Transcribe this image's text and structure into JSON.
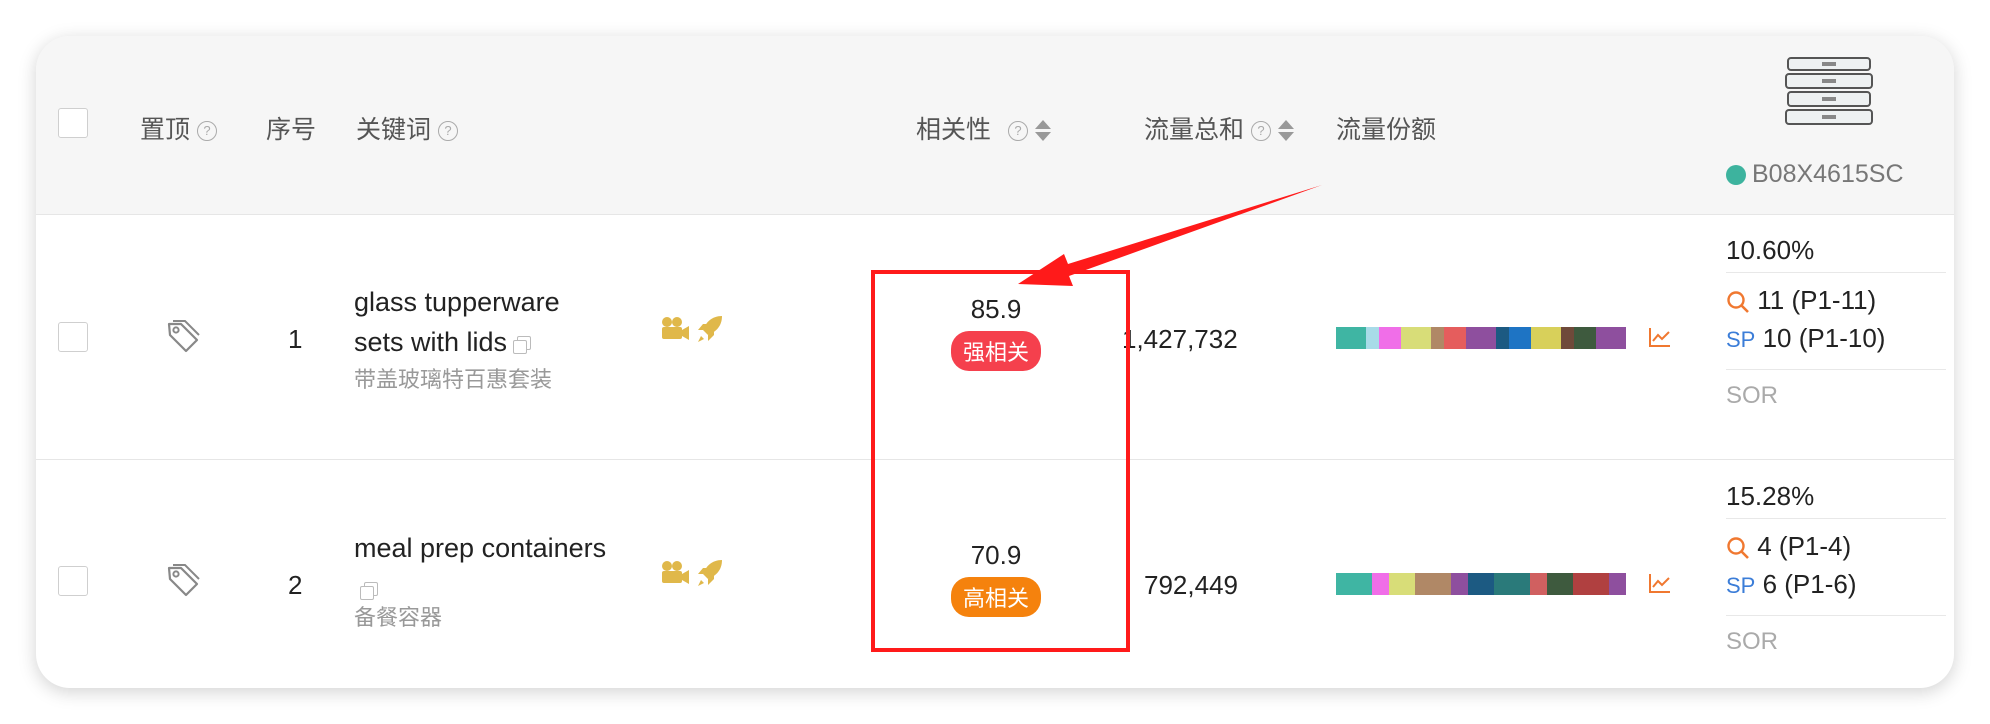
{
  "header": {
    "pin": "置顶",
    "index": "序号",
    "keyword": "关键词",
    "relevance": "相关性",
    "traffic_total": "流量总和",
    "traffic_share": "流量份额",
    "asin": "B08X4615SC",
    "asin_dot_color": "#3db39e"
  },
  "rows": [
    {
      "index": "1",
      "keyword_line1": "glass tupperware",
      "keyword_line2": "sets with lids",
      "keyword_cn": "带盖玻璃特百惠套装",
      "relevance_score": "85.9",
      "relevance_label": "强相关",
      "relevance_color": "#f5404d",
      "traffic": "1,427,732",
      "share_pct": "10.60%",
      "organic_rank": "11 (P1-11)",
      "sp_rank": "10 (P1-10)",
      "sp_label": "SP",
      "sor": "SOR"
    },
    {
      "index": "2",
      "keyword_line1": "meal prep containers",
      "keyword_cn": "备餐容器",
      "relevance_score": "70.9",
      "relevance_label": "高相关",
      "relevance_color": "#f5820d",
      "traffic": "792,449",
      "share_pct": "15.28%",
      "organic_rank": "4 (P1-4)",
      "sp_rank": "6 (P1-6)",
      "sp_label": "SP",
      "sor": "SOR"
    }
  ],
  "share_bar_colors": {
    "row1": [
      "#3fb5a3",
      "#a8dbe8",
      "#f06ee8",
      "#d8dd78",
      "#b08866",
      "#e55d5d",
      "#8e4f9e",
      "#1c5a82",
      "#1e74c4",
      "#d8d05a",
      "#6f4a3a",
      "#3e5a3e",
      "#8e4f9e"
    ],
    "row2": [
      "#3fb5a3",
      "#f06ee8",
      "#d8dd78",
      "#b08866",
      "#8e4f9e",
      "#1c5a82",
      "#2a7a7a",
      "#d06060",
      "#3e5a3e",
      "#b04040",
      "#8e4f9e"
    ]
  },
  "annotation_color": "#ff1a1a",
  "accent_orange": "#f07830",
  "sp_color": "#3b7dd8"
}
